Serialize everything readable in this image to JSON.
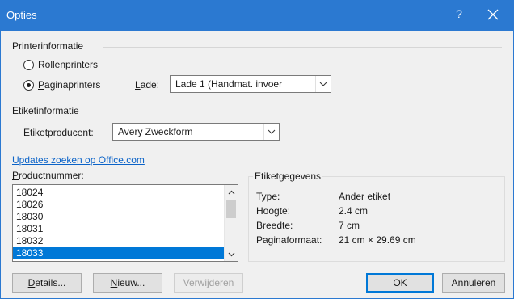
{
  "window": {
    "title": "Opties",
    "help_label": "?"
  },
  "printer_info": {
    "heading": "Printerinformatie",
    "radio_roll": {
      "accel": "R",
      "rest": "ollenprinters",
      "checked": false
    },
    "radio_page": {
      "accel": "P",
      "rest": "aginaprinters",
      "checked": true
    },
    "tray_label_accel": "L",
    "tray_label_rest": "ade:",
    "tray_value": "Lade 1 (Handmat. invoer"
  },
  "label_info": {
    "heading": "Etiketinformatie",
    "vendor_label_accel": "E",
    "vendor_label_rest": "tiketproducent:",
    "vendor_value": "Avery Zweckform"
  },
  "updates_link": "Updates zoeken op Office.com",
  "product_number": {
    "label_accel": "P",
    "label_rest": "roductnummer:",
    "items": [
      "18024",
      "18026",
      "18030",
      "18031",
      "18032",
      "18033"
    ],
    "selected": "18033"
  },
  "label_details": {
    "heading": "Etiketgegevens",
    "rows": [
      {
        "key": "Type:",
        "value": "Ander etiket"
      },
      {
        "key": "Hoogte:",
        "value": "2.4 cm"
      },
      {
        "key": "Breedte:",
        "value": "7 cm"
      },
      {
        "key": "Paginaformaat:",
        "value": "21 cm × 29.69 cm"
      }
    ]
  },
  "buttons": {
    "details_accel": "D",
    "details_rest": "etails...",
    "new_accel": "N",
    "new_rest": "ieuw...",
    "delete_label": "Verwijderen",
    "ok_label": "OK",
    "cancel_label": "Annuleren"
  },
  "colors": {
    "titlebar": "#2b79d1",
    "selection": "#0078d7",
    "link": "#0b63c8"
  }
}
